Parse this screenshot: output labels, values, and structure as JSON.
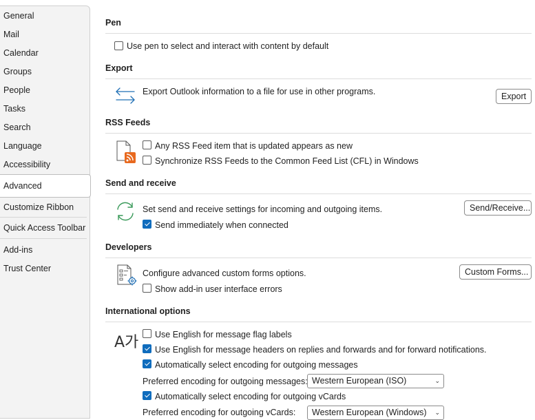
{
  "sidebar": {
    "items": [
      {
        "label": "General"
      },
      {
        "label": "Mail"
      },
      {
        "label": "Calendar"
      },
      {
        "label": "Groups"
      },
      {
        "label": "People"
      },
      {
        "label": "Tasks"
      },
      {
        "label": "Search"
      },
      {
        "label": "Language"
      },
      {
        "label": "Accessibility"
      },
      {
        "label": "Advanced",
        "selected": true
      },
      {
        "label": "Customize Ribbon"
      },
      {
        "label": "Quick Access Toolbar"
      },
      {
        "label": "Add-ins"
      },
      {
        "label": "Trust Center"
      }
    ]
  },
  "pen": {
    "header": "Pen",
    "use_pen": {
      "label": "Use pen to select and interact with content by default",
      "checked": false
    }
  },
  "export": {
    "header": "Export",
    "description": "Export Outlook information to a file for use in other programs.",
    "button": "Export",
    "icon": "export-arrows-icon"
  },
  "rss": {
    "header": "RSS Feeds",
    "icon": "rss-document-icon",
    "any_feed": {
      "label": "Any RSS Feed item that is updated appears as new",
      "checked": false
    },
    "sync_cfl": {
      "label": "Synchronize RSS Feeds to the Common Feed List (CFL) in Windows",
      "checked": false
    }
  },
  "send_receive": {
    "header": "Send and receive",
    "icon": "sync-icon",
    "description": "Set send and receive settings for incoming and outgoing items.",
    "button": "Send/Receive...",
    "send_immediately": {
      "label": "Send immediately when connected",
      "checked": true
    }
  },
  "developers": {
    "header": "Developers",
    "icon": "custom-forms-icon",
    "description": "Configure advanced custom forms options.",
    "button": "Custom Forms...",
    "show_errors": {
      "label": "Show add-in user interface errors",
      "checked": false
    }
  },
  "international": {
    "header": "International options",
    "icon_glyph": "A가",
    "flag_labels": {
      "label": "Use English for message flag labels",
      "checked": false
    },
    "message_headers": {
      "label": "Use English for message headers on replies and forwards and for forward notifications.",
      "checked": true
    },
    "auto_encoding": {
      "label": "Automatically select encoding for outgoing messages",
      "checked": true
    },
    "pref_encoding_label": "Preferred encoding for outgoing messages:",
    "pref_encoding_value": "Western European (ISO)",
    "auto_vcard": {
      "label": "Automatically select encoding for outgoing vCards",
      "checked": true
    },
    "pref_vcard_label": "Preferred encoding for outgoing vCards:",
    "pref_vcard_value": "Western European (Windows)"
  },
  "colors": {
    "accent": "#0f6cbd",
    "sync_green": "#3a9a5a",
    "rss_orange": "#e8691f",
    "export_blue": "#1f6fb5"
  }
}
